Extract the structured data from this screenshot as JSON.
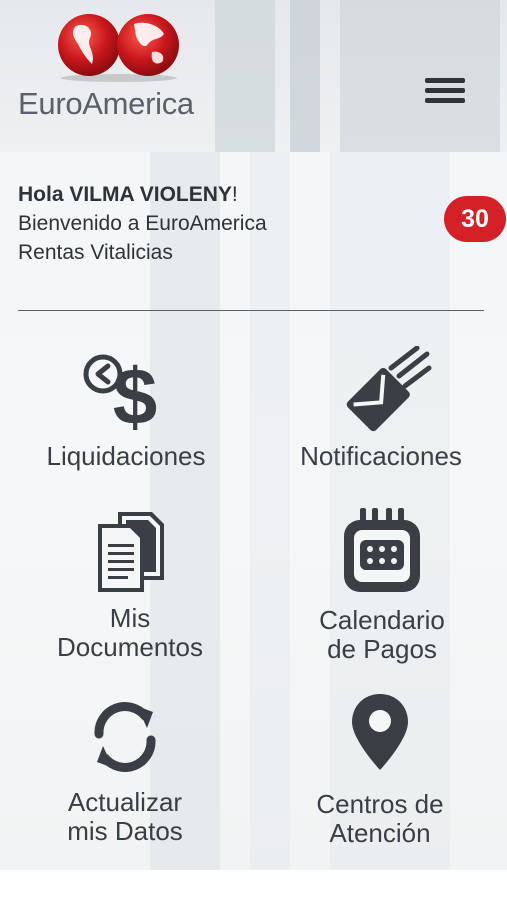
{
  "app": {
    "brand_name": "EuroAmerica",
    "logo_icon": "globes-logo-icon",
    "menu_icon": "hamburger-icon",
    "brand_color": "#d42027"
  },
  "greeting": {
    "prefix": "Hola ",
    "user_name": "VILMA VIOLENY",
    "suffix": "!",
    "line2": "Bienvenido a EuroAmerica",
    "line3": "Rentas Vitalicias"
  },
  "notifications_badge": "30",
  "menu_tiles": [
    {
      "label_line1": "Liquidaciones",
      "label_line2": "",
      "icon": "money-clock-icon"
    },
    {
      "label_line1": "Notificaciones",
      "label_line2": "",
      "icon": "envelope-icon"
    },
    {
      "label_line1": "Mis",
      "label_line2": "Documentos",
      "icon": "documents-icon"
    },
    {
      "label_line1": "Calendario",
      "label_line2": "de Pagos",
      "icon": "calendar-icon"
    },
    {
      "label_line1": "Actualizar",
      "label_line2": "mis Datos",
      "icon": "refresh-icon"
    },
    {
      "label_line1": "Centros de",
      "label_line2": "Atención",
      "icon": "location-pin-icon"
    }
  ]
}
